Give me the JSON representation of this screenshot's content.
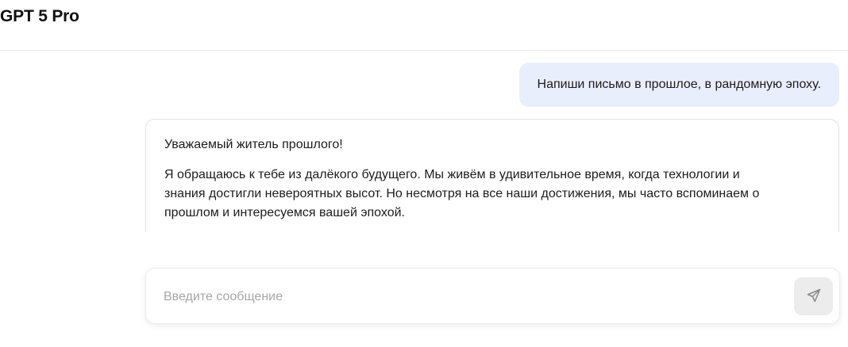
{
  "header": {
    "title": "GPT 5 Pro"
  },
  "messages": {
    "user": {
      "text": "Напиши письмо в прошлое, в рандомную эпоху."
    },
    "assistant": {
      "greeting": "Уважаемый житель прошлого!",
      "paragraph": "Я обращаюсь к тебе из далёкого будущего. Мы живём в удивительное время, когда технологии и знания достигли невероятных высот. Но несмотря на все наши достижения, мы часто вспоминаем о прошлом и интересуемся вашей эпохой."
    }
  },
  "composer": {
    "placeholder": "Введите сообщение",
    "send_icon": "send-icon"
  },
  "colors": {
    "user_bubble": "#e9eefc",
    "send_button": "#ececec",
    "placeholder": "#a6a6a6"
  }
}
